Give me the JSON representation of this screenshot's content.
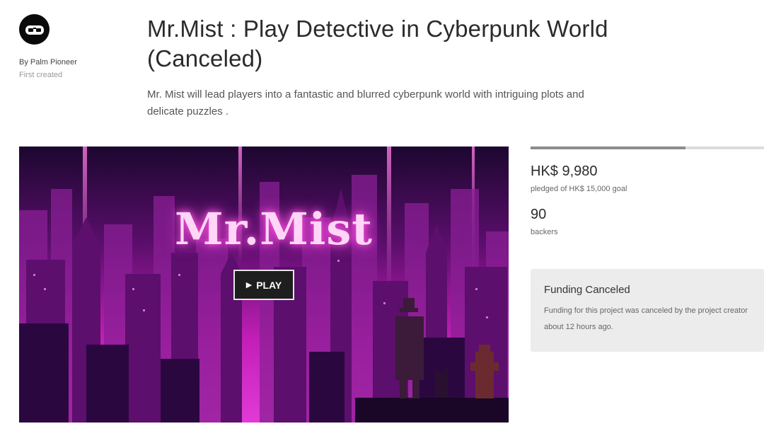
{
  "creator": {
    "avatar_icon": "gamepad-icon",
    "by_line": "By Palm Pioneer",
    "created_label": "First created"
  },
  "project": {
    "title": "Mr.Mist : Play Detective in Cyberpunk World (Canceled)",
    "blurb": "Mr. Mist will lead players into a fantastic and blurred cyberpunk world with intriguing plots and delicate puzzles ."
  },
  "video": {
    "logo_text": "Mr.Mist",
    "play_label": "PLAY",
    "play_icon": "play-icon"
  },
  "stats": {
    "progress_fraction": 0.665,
    "pledged": "HK$ 9,980",
    "pledged_goal": "pledged of HK$ 15,000 goal",
    "backers": "90",
    "backers_label": "backers"
  },
  "status": {
    "title": "Funding Canceled",
    "message": "Funding for this project was canceled by the project creator about 12 hours ago."
  },
  "colors": {
    "scene_dark": "#2a0638",
    "scene_magenta": "#d627c9",
    "logo_pink": "#ffd6f7",
    "panel_gray": "#ececec",
    "progress_fill": "#8c8c8c"
  }
}
